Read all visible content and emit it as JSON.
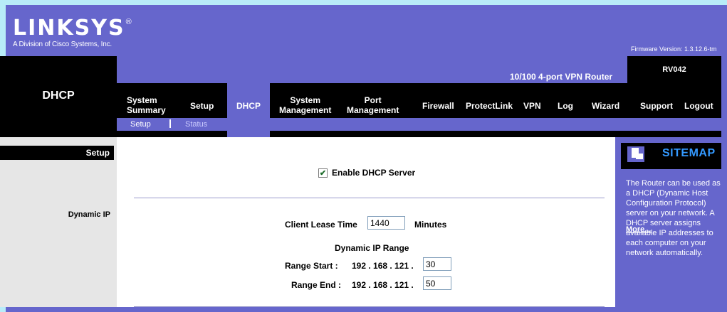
{
  "header": {
    "brand": "LINKSYS",
    "brand_mark": "®",
    "division": "A Division of Cisco Systems, Inc.",
    "firmware": "Firmware Version: 1.3.12.6-tm"
  },
  "section_title": "DHCP",
  "product": {
    "name": "10/100 4-port VPN Router",
    "model": "RV042"
  },
  "tabs": [
    {
      "label": "System Summary",
      "active": false
    },
    {
      "label": "Setup",
      "active": false
    },
    {
      "label": "DHCP",
      "active": true
    },
    {
      "label": "System Management",
      "active": false
    },
    {
      "label": "Port Management",
      "active": false
    },
    {
      "label": "Firewall",
      "active": false
    },
    {
      "label": "ProtectLink",
      "active": false
    },
    {
      "label": "VPN",
      "active": false
    },
    {
      "label": "Log",
      "active": false
    },
    {
      "label": "Wizard",
      "active": false
    },
    {
      "label": "Support",
      "active": false
    },
    {
      "label": "Logout",
      "active": false
    }
  ],
  "tab_lines": {
    "system_summary": [
      "System",
      "Summary"
    ],
    "system_management": [
      "System",
      "Management"
    ],
    "port_management": [
      "Port",
      "Management"
    ]
  },
  "subtabs": [
    {
      "label": "Setup",
      "active": true
    },
    {
      "label": "Status",
      "active": false
    }
  ],
  "left": {
    "setup": "Setup",
    "dynamic_ip": "Dynamic IP"
  },
  "form": {
    "enable_dhcp_label": "Enable DHCP Server",
    "enable_dhcp_checked": true,
    "client_lease_label": "Client Lease Time",
    "client_lease_value": "1440",
    "minutes_label": "Minutes",
    "dynamic_range_label": "Dynamic IP Range",
    "range_start_label": "Range Start :",
    "range_start_prefix": "192 . 168 . 121 .",
    "range_start_value": "30",
    "range_end_label": "Range End :",
    "range_end_prefix": "192 . 168 . 121 .",
    "range_end_value": "50"
  },
  "sitemap": {
    "title": "SITEMAP",
    "text": "The Router can be used as a DHCP (Dynamic Host Configuration Protocol) server on your network. A DHCP server assigns available IP addresses to each computer on your network automatically.",
    "more": "More..."
  },
  "colors": {
    "brand_purple": "#6666cc",
    "nav_black": "#000000",
    "page_bg": "#b8ecf8",
    "sitemap_title": "#3399ff"
  }
}
